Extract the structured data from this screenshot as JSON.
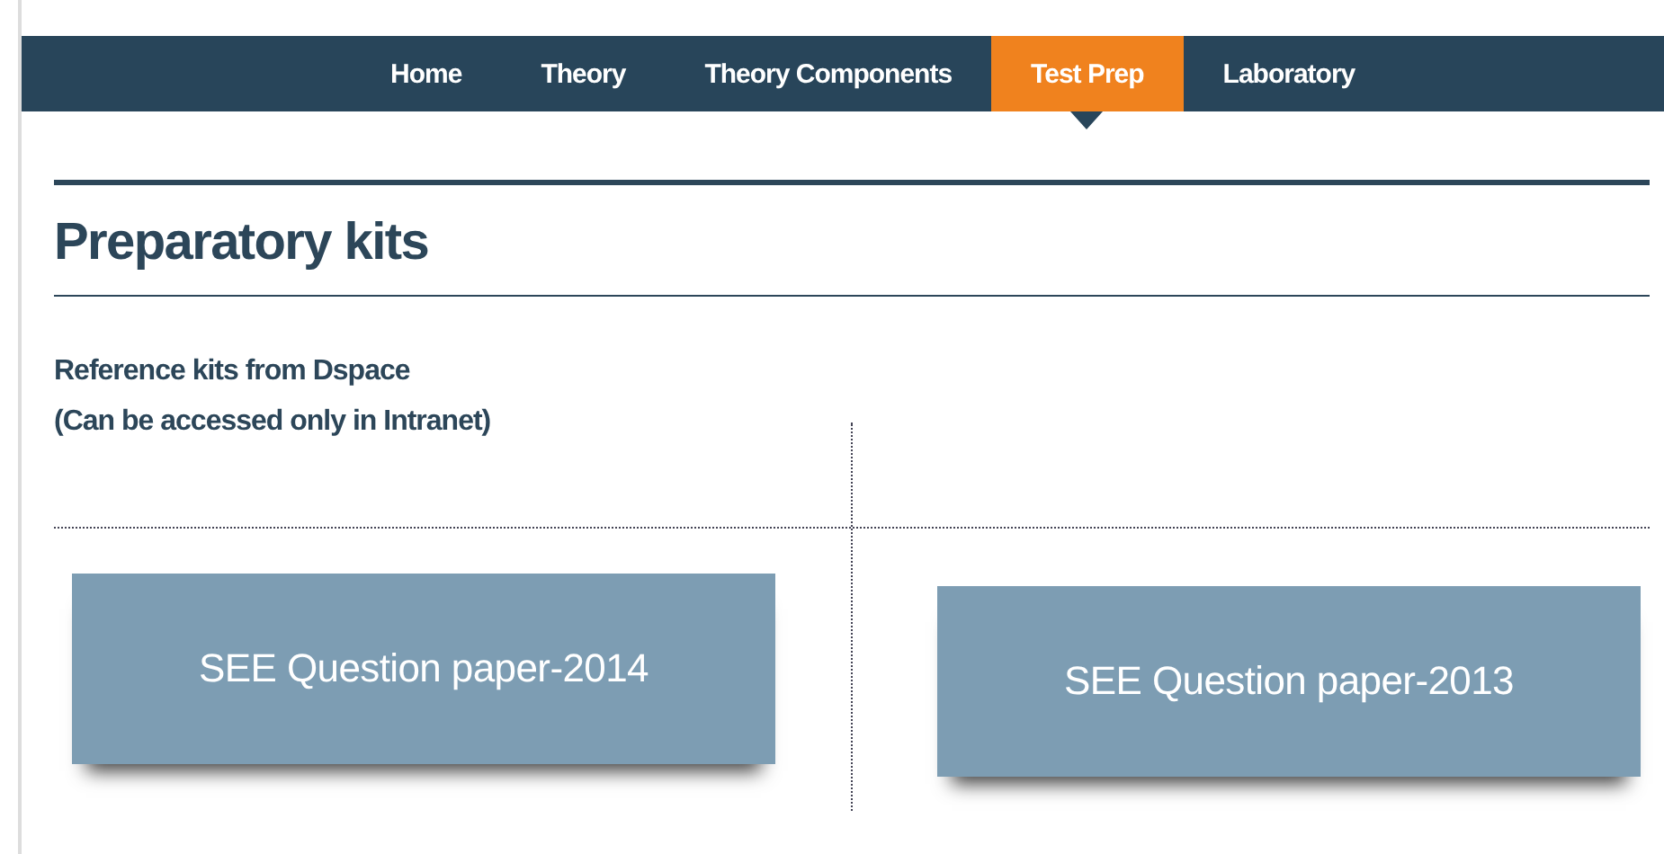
{
  "nav": {
    "tabs": [
      {
        "label": "Home",
        "selected": false
      },
      {
        "label": "Theory",
        "selected": false
      },
      {
        "label": "Theory Components",
        "selected": false
      },
      {
        "label": "Test Prep",
        "selected": true
      },
      {
        "label": "Laboratory",
        "selected": false
      }
    ]
  },
  "heading": "Preparatory kits",
  "subheading": [
    "Reference kits from Dspace",
    "(Can be accessed only in Intranet)"
  ],
  "kits": [
    {
      "label": "SEE Question paper-2014"
    },
    {
      "label": "SEE Question paper-2013"
    }
  ]
}
